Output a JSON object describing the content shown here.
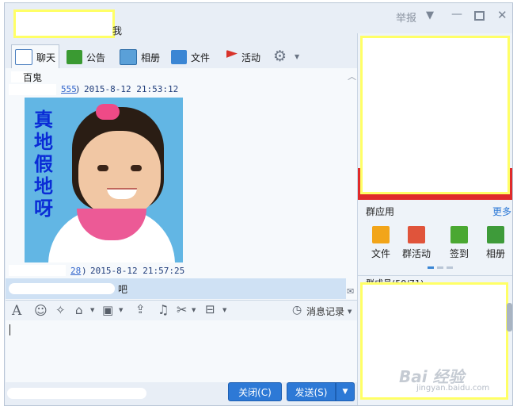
{
  "header": {
    "group_name_tail": "我",
    "report_label": "举报"
  },
  "toolbar": {
    "tabs": [
      {
        "label": "聊天",
        "icon": "chat-bubble-icon"
      },
      {
        "label": "公告",
        "icon": "announcement-flag-icon"
      },
      {
        "label": "相册",
        "icon": "album-picture-icon"
      },
      {
        "label": "文件",
        "icon": "folder-icon"
      },
      {
        "label": "活动",
        "icon": "red-flag-icon"
      }
    ]
  },
  "chat": {
    "messages": [
      {
        "sender_fragment": "百鬼",
        "id_fragment": "555",
        "timestamp": "2015-8-12 21:53:12",
        "image_caption": "真地假地呀"
      },
      {
        "id_fragment": "28",
        "timestamp": "2015-8-12 21:57:25"
      }
    ],
    "highlight_tail": "吧"
  },
  "format_toolbar": {
    "history_label": "消息记录"
  },
  "buttons": {
    "close_label": "关闭(C)",
    "send_label": "发送(S)"
  },
  "side": {
    "group_apps_title": "群应用",
    "more_label": "更多",
    "apps": [
      {
        "label": "文件",
        "icon": "folder-app-icon",
        "color": "#f2a51a"
      },
      {
        "label": "群活动",
        "icon": "activity-flag-app-icon",
        "color": "#e0543b"
      },
      {
        "label": "签到",
        "icon": "checkin-app-icon",
        "color": "#4aa832"
      },
      {
        "label": "相册",
        "icon": "album-app-icon",
        "color": "#3e9b3a"
      }
    ],
    "members_label": "群成员(50/71)"
  },
  "watermark": {
    "brand": "Bai 经验",
    "url": "jingyan.baidu.com"
  },
  "colors": {
    "accent_blue": "#2d79d6",
    "mask_border": "#ffff66",
    "window_bg": "#e8eef6"
  }
}
